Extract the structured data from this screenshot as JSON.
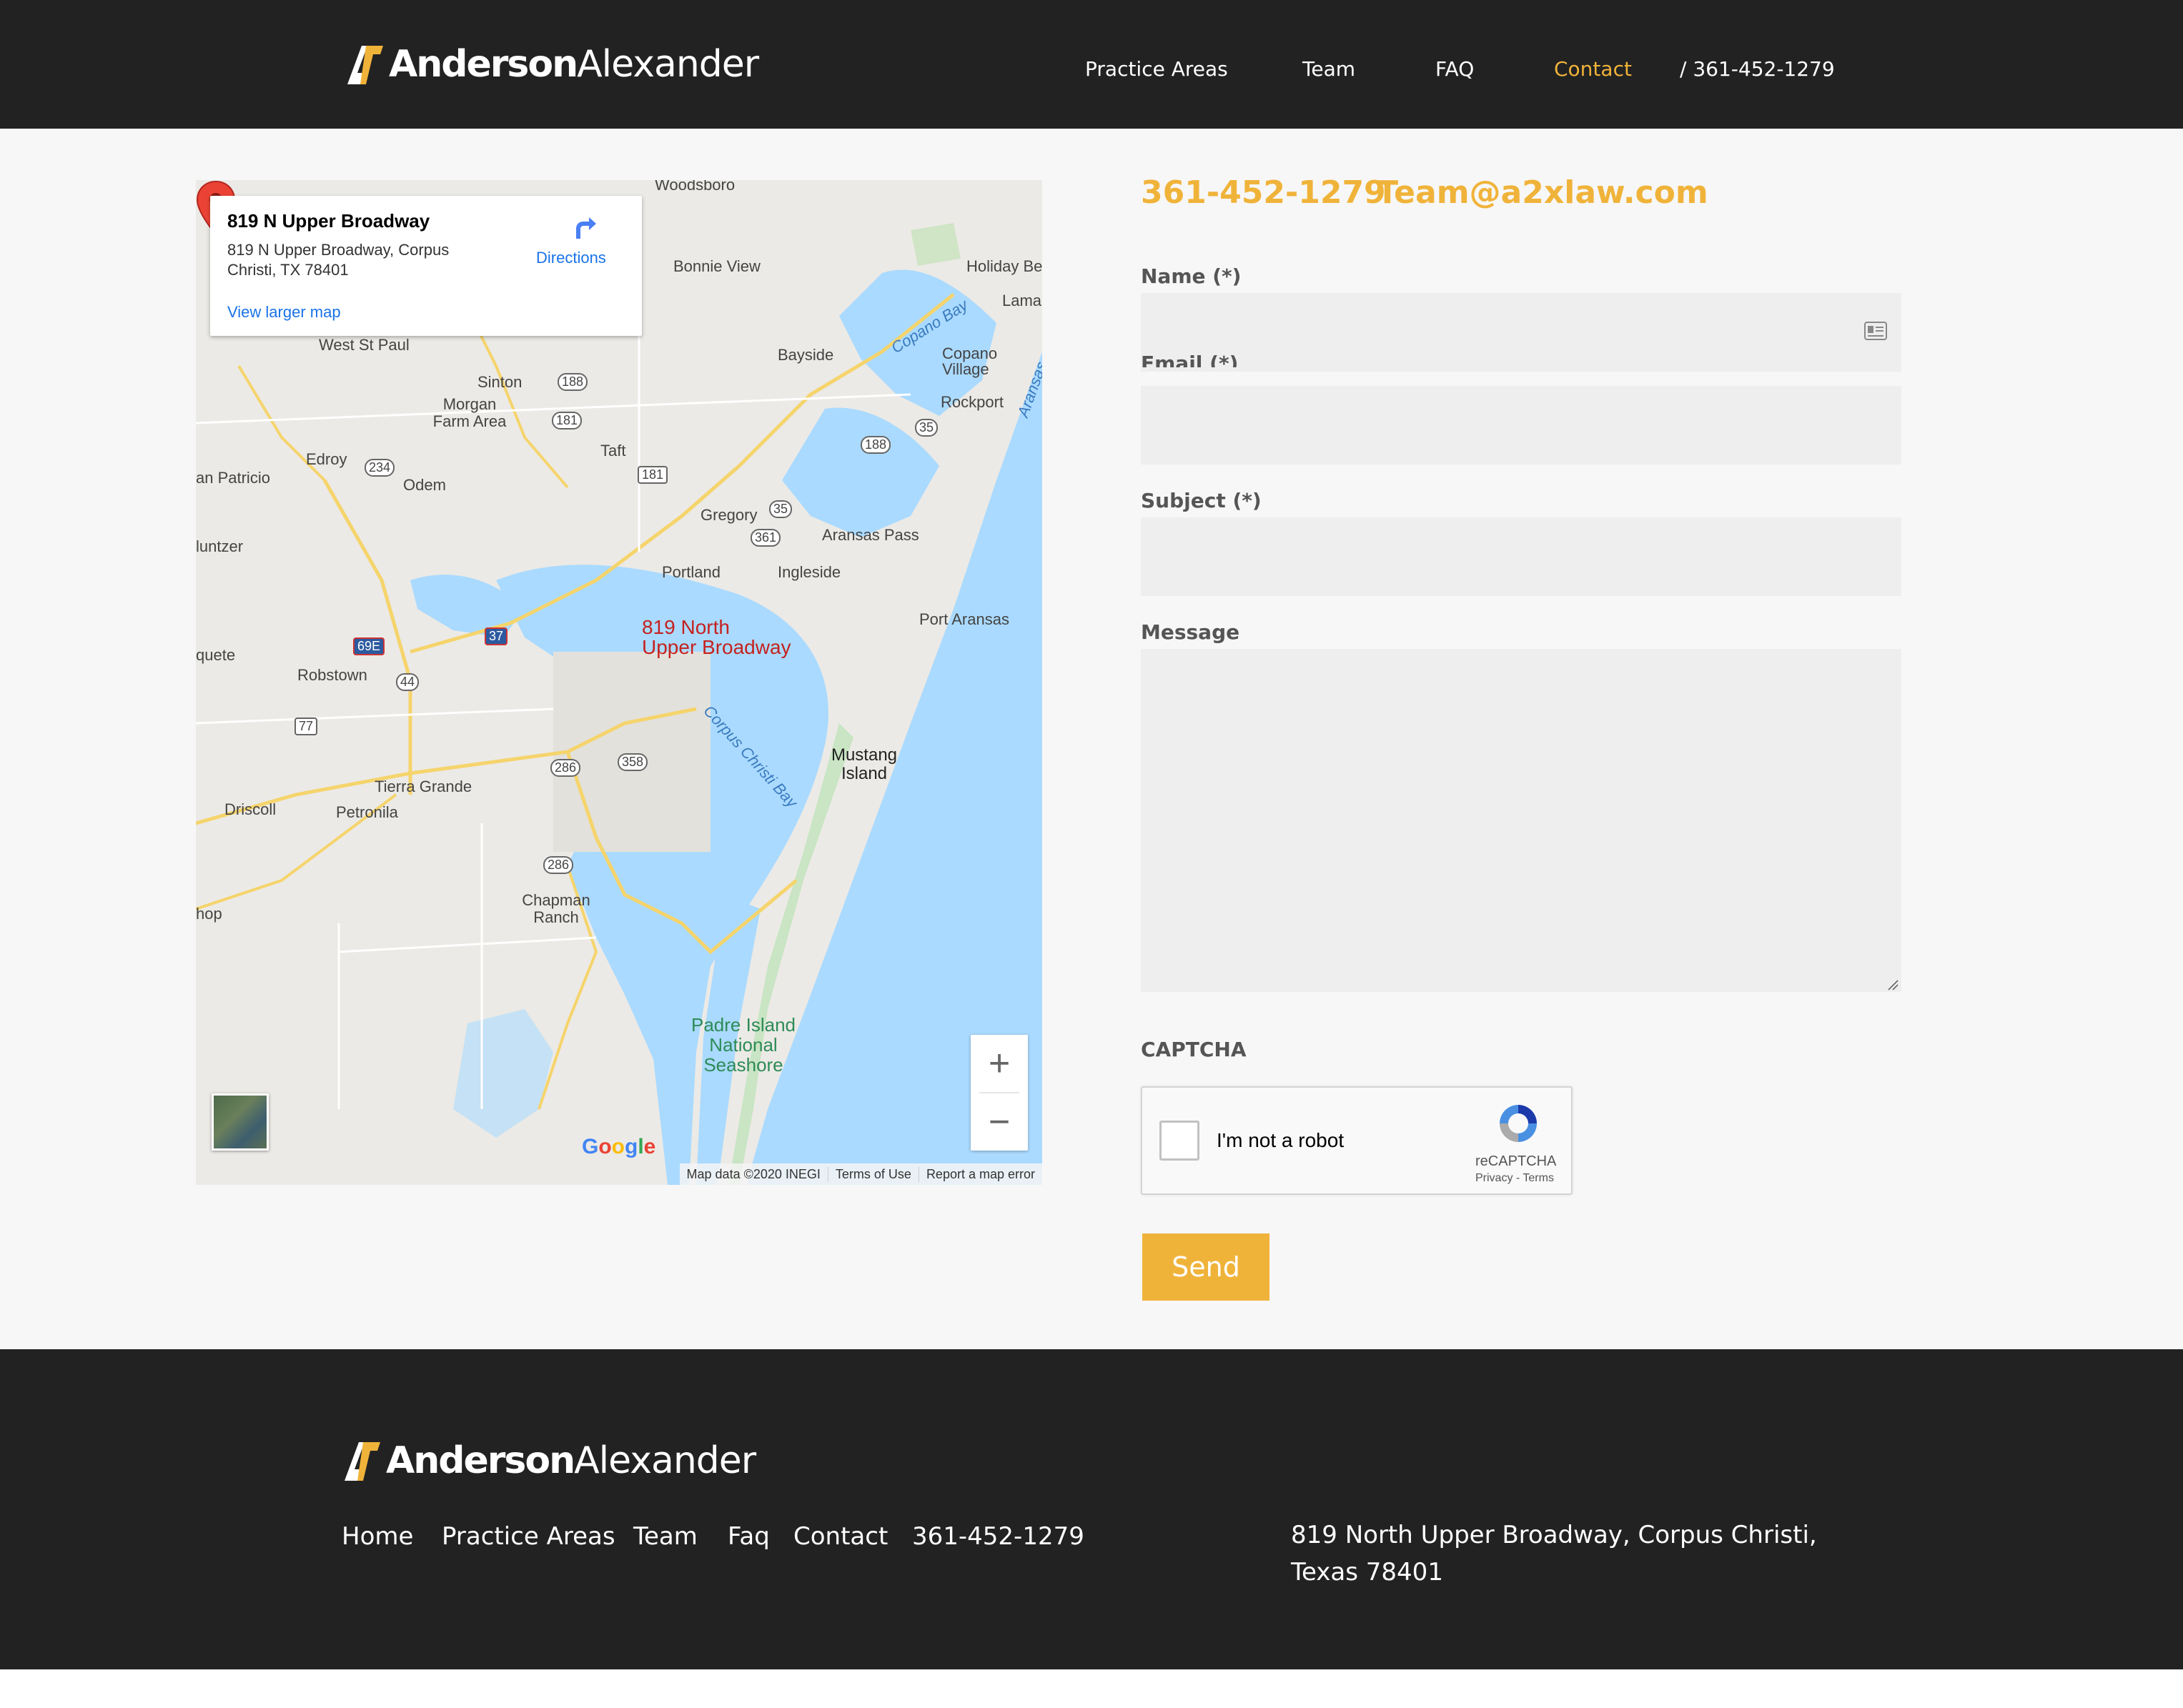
{
  "header": {
    "logo": {
      "bold": "Anderson",
      "light": "Alexander"
    },
    "nav": [
      {
        "label": "Practice Areas",
        "active": false
      },
      {
        "label": "Team",
        "active": false
      },
      {
        "label": "FAQ",
        "active": false
      },
      {
        "label": "Contact",
        "active": true
      },
      {
        "label": "/ 361-452-1279",
        "active": false
      }
    ]
  },
  "map": {
    "card": {
      "title": "819 N Upper Broadway",
      "address": "819 N Upper Broadway, Corpus Christi, TX 78401",
      "larger_map": "View larger map",
      "directions": "Directions"
    },
    "pin_label_line1": "819 North",
    "pin_label_line2": "Upper Broadway",
    "places": {
      "woodsboro": "Woodsboro",
      "bonnie_view": "Bonnie View",
      "holiday_beach": "Holiday Be",
      "lamar": "Lama",
      "copano_bay": "Copano Bay",
      "copano_village": "Copano Village",
      "bayside": "Bayside",
      "west_st_paul": "West St Paul",
      "sinton": "Sinton",
      "morgan_farm": "Morgan Farm Area",
      "rockport": "Rockport",
      "aransas": "Aransas",
      "edroy": "Edroy",
      "taft": "Taft",
      "odem": "Odem",
      "san_patricio": "an Patricio",
      "gregory": "Gregory",
      "aransas_pass": "Aransas Pass",
      "luntzer": "luntzer",
      "portland": "Portland",
      "ingleside": "Ingleside",
      "port_aransas": "Port Aransas",
      "quete": "quete",
      "robstown": "Robstown",
      "corpus_christi_bay": "Corpus Christi Bay",
      "mustang_island": "Mustang Island",
      "tierra_grande": "Tierra Grande",
      "driscoll": "Driscoll",
      "petronila": "Petronila",
      "chapman_ranch": "Chapman Ranch",
      "hop": "hop",
      "padre_island": "Padre Island National Seashore"
    },
    "shields": [
      "188",
      "181",
      "234",
      "181",
      "188",
      "35",
      "35",
      "361",
      "69E",
      "37",
      "44",
      "77",
      "286",
      "358",
      "286"
    ],
    "google": "Google",
    "attribution": [
      "Map data ©2020 INEGI",
      "Terms of Use",
      "Report a map error"
    ],
    "zoom_in": "+",
    "zoom_out": "−"
  },
  "contact": {
    "phone": "361-452-1279",
    "email": "Team@a2xlaw.com",
    "fields": {
      "name_label": "Name (*)",
      "email_label": "Email (*)",
      "subject_label": "Subject (*)",
      "message_label": "Message"
    },
    "captcha": {
      "label": "CAPTCHA",
      "checkbox_text": "I'm not a robot",
      "brand": "reCAPTCHA",
      "links": "Privacy - Terms"
    },
    "send_label": "Send"
  },
  "footer": {
    "logo": {
      "bold": "Anderson",
      "light": "Alexander"
    },
    "links": [
      "Home",
      "Practice Areas",
      "Team",
      "Faq",
      "Contact",
      "361-452-1279"
    ],
    "address": "819 North Upper Broadway, Corpus Christi, Texas 78401"
  },
  "colors": {
    "accent": "#f0b33a",
    "dark": "#222222",
    "water": "#aadaff",
    "pin": "#ea4335"
  }
}
